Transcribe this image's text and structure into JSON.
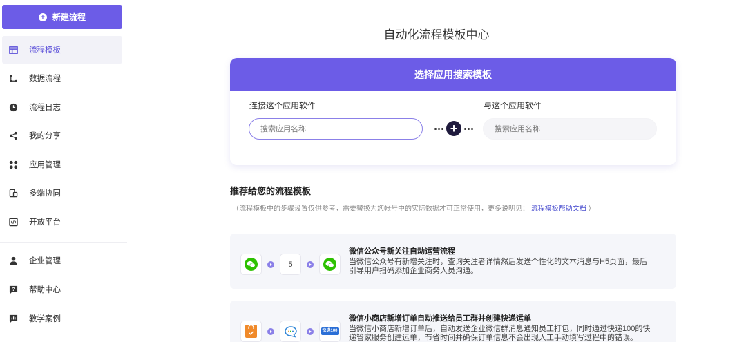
{
  "sidebar": {
    "new_flow_label": "新建流程",
    "items": [
      {
        "label": "流程模板",
        "icon": "template-icon",
        "active": true
      },
      {
        "label": "数据流程",
        "icon": "flow-icon"
      },
      {
        "label": "流程日志",
        "icon": "clock-icon"
      },
      {
        "label": "我的分享",
        "icon": "share-icon"
      },
      {
        "label": "应用管理",
        "icon": "apps-icon"
      },
      {
        "label": "多端协同",
        "icon": "devices-icon"
      },
      {
        "label": "开放平台",
        "icon": "code-icon"
      }
    ],
    "bottom_items": [
      {
        "label": "企业管理",
        "icon": "person-icon"
      },
      {
        "label": "帮助中心",
        "icon": "help-icon"
      },
      {
        "label": "教学案例",
        "icon": "chart-icon"
      }
    ]
  },
  "main": {
    "title": "自动化流程模板中心",
    "search": {
      "header": "选择应用搜索模板",
      "left_label": "连接这个应用软件",
      "left_placeholder": "搜索应用名称",
      "right_label": "与这个应用软件",
      "right_placeholder": "搜索应用名称"
    },
    "recommend": {
      "title": "推荐给您的流程模板",
      "note_prefix": "（流程模板中的步骤设置仅供参考，需要替换为您帐号中的实际数据才可正常使用，更多说明见：",
      "note_link": "流程模板帮助文档",
      "note_suffix": "）"
    },
    "templates": [
      {
        "title": "微信公众号新关注自动运营流程",
        "description": "当微信公众号有新增关注时，查询关注者详情然后发送个性化的文本消息与H5页面，最后引导用户扫码添加企业商务人员沟通。",
        "step_number": "5"
      },
      {
        "title": "微信小商店新增订单自动推送给员工群并创建快递运单",
        "description": "当微信小商店新增订单后，自动发送企业微信群消息通知员工打包，同时通过快递100的快递管家服务创建运单，节省时间并确保订单信息不会出现人工手动填写过程中的错误。",
        "logo_text": "快递100"
      }
    ]
  },
  "colors": {
    "accent": "#6c5ce7",
    "active_nav_bg": "#f2f2f8",
    "wechat_green": "#2dc100"
  }
}
